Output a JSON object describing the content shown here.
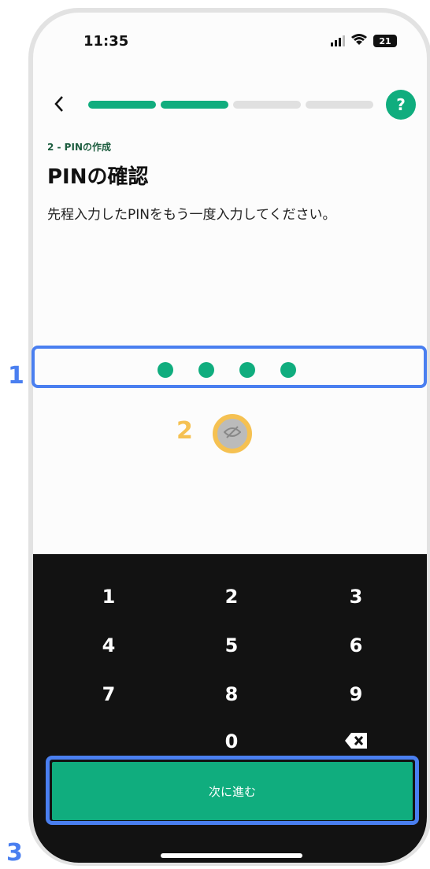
{
  "status_bar": {
    "time": "11:35",
    "battery": "21"
  },
  "header": {
    "back_icon": "chevron-left-icon",
    "help_label": "?",
    "progress": {
      "steps_total": 4,
      "steps_done": 2,
      "active_color": "#10ad7e",
      "inactive_color": "#e0e0e0"
    }
  },
  "content": {
    "step_label": "2 - PINの作成",
    "title": "PINの確認",
    "description": "先程入力したPINをもう一度入力してください。"
  },
  "pin": {
    "entered_count": 4,
    "visibility_icon": "eye-off-icon"
  },
  "keypad": {
    "keys": [
      "1",
      "2",
      "3",
      "4",
      "5",
      "6",
      "7",
      "8",
      "9",
      "0"
    ],
    "delete_icon": "backspace-icon",
    "submit_label": "次に進む"
  },
  "annotations": {
    "one": "1",
    "two": "2",
    "three": "3"
  },
  "colors": {
    "accent": "#10ad7e",
    "highlight_blue": "#4a7ff0",
    "highlight_yellow": "#f5c152"
  }
}
